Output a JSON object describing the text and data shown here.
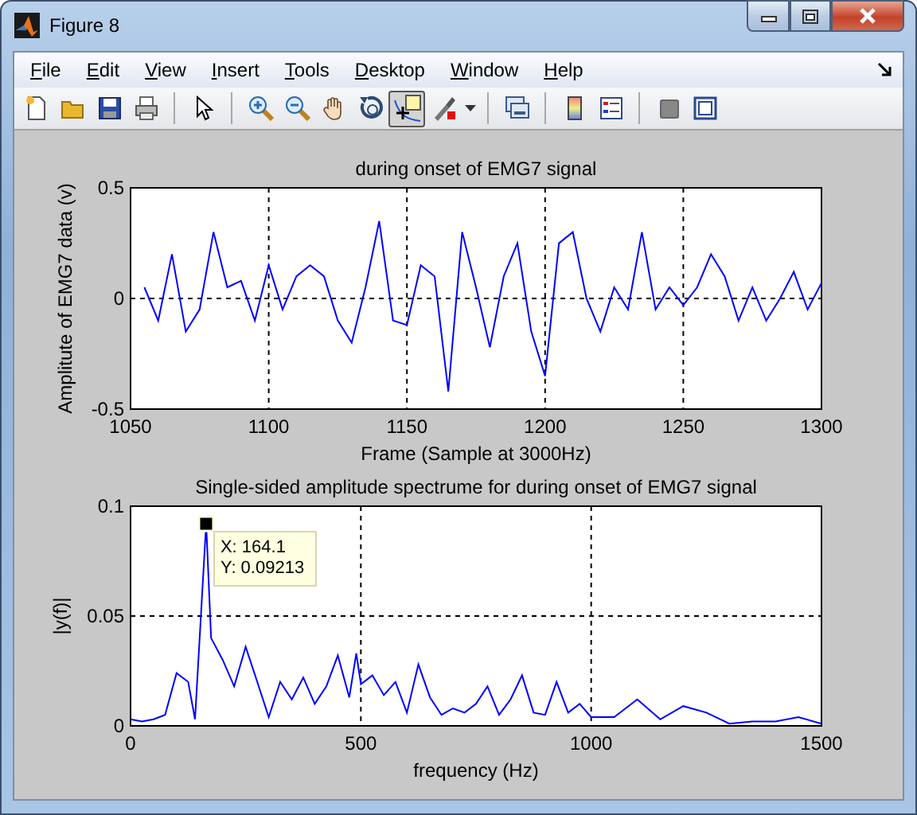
{
  "window": {
    "title": "Figure 8"
  },
  "menu": [
    {
      "label": "File"
    },
    {
      "label": "Edit"
    },
    {
      "label": "View"
    },
    {
      "label": "Insert"
    },
    {
      "label": "Tools"
    },
    {
      "label": "Desktop"
    },
    {
      "label": "Window"
    },
    {
      "label": "Help"
    }
  ],
  "toolbar": {
    "groups": [
      [
        {
          "kind": "new",
          "selected": false
        },
        {
          "kind": "open",
          "selected": false
        },
        {
          "kind": "save",
          "selected": false
        },
        {
          "kind": "print",
          "selected": false
        }
      ],
      [
        {
          "kind": "pointer",
          "selected": false
        }
      ],
      [
        {
          "kind": "zoom-in",
          "selected": false
        },
        {
          "kind": "zoom-out",
          "selected": false
        },
        {
          "kind": "pan",
          "selected": false
        },
        {
          "kind": "rotate",
          "selected": false
        },
        {
          "kind": "data-cursor",
          "selected": true
        },
        {
          "kind": "brush",
          "selected": false
        }
      ],
      [
        {
          "kind": "link",
          "selected": false
        }
      ],
      [
        {
          "kind": "colorbar",
          "selected": false
        },
        {
          "kind": "legend",
          "selected": false
        }
      ],
      [
        {
          "kind": "hide-tools",
          "selected": false
        },
        {
          "kind": "show-tools",
          "selected": false
        }
      ]
    ]
  },
  "figure": {
    "axes": [
      {
        "chart_data": {
          "type": "line",
          "grid": true,
          "title": "during onset of EMG7 signal",
          "xlabel": "Frame (Sample at 3000Hz)",
          "ylabel": "Amplitute of EMG7 data (v)",
          "xlim": [
            1050,
            1300
          ],
          "ylim": [
            -0.5,
            0.5
          ],
          "xticks": [
            {
              "value": 1050,
              "label": "1050"
            },
            {
              "value": 1100,
              "label": "1100"
            },
            {
              "value": 1150,
              "label": "1150"
            },
            {
              "value": 1200,
              "label": "1200"
            },
            {
              "value": 1250,
              "label": "1250"
            },
            {
              "value": 1300,
              "label": "1300"
            }
          ],
          "yticks": [
            {
              "value": -0.5,
              "label": "-0.5"
            },
            {
              "value": 0,
              "label": "0"
            },
            {
              "value": 0.5,
              "label": "0.5"
            }
          ],
          "x": [
            1055,
            1060,
            1065,
            1070,
            1075,
            1080,
            1085,
            1090,
            1095,
            1100,
            1105,
            1110,
            1115,
            1120,
            1125,
            1130,
            1135,
            1140,
            1145,
            1150,
            1155,
            1160,
            1165,
            1170,
            1175,
            1180,
            1185,
            1190,
            1195,
            1200,
            1205,
            1210,
            1215,
            1220,
            1225,
            1230,
            1235,
            1240,
            1245,
            1250,
            1255,
            1260,
            1265,
            1270,
            1275,
            1280,
            1285,
            1290,
            1295,
            1300
          ],
          "series": [
            {
              "color": "#0000ff",
              "values": [
                0.05,
                -0.1,
                0.2,
                -0.15,
                -0.05,
                0.3,
                0.05,
                0.08,
                -0.1,
                0.15,
                -0.05,
                0.1,
                0.15,
                0.1,
                -0.1,
                -0.2,
                0.05,
                0.35,
                -0.1,
                -0.12,
                0.15,
                0.1,
                -0.42,
                0.3,
                0.05,
                -0.22,
                0.1,
                0.25,
                -0.15,
                -0.35,
                0.25,
                0.3,
                0.0,
                -0.15,
                0.05,
                -0.05,
                0.3,
                -0.05,
                0.05,
                -0.03,
                0.05,
                0.2,
                0.1,
                -0.1,
                0.05,
                -0.1,
                0.0,
                0.12,
                -0.05,
                0.07
              ]
            }
          ]
        }
      },
      {
        "chart_data": {
          "type": "line",
          "grid": true,
          "title": "Single-sided amplitude spectrume for during onset of EMG7 signal",
          "xlabel": "frequency (Hz)",
          "ylabel": "|y(f)|",
          "xlim": [
            0,
            1500
          ],
          "ylim": [
            0,
            0.1
          ],
          "xticks": [
            {
              "value": 0,
              "label": "0"
            },
            {
              "value": 500,
              "label": "500"
            },
            {
              "value": 1000,
              "label": "1000"
            },
            {
              "value": 1500,
              "label": "1500"
            }
          ],
          "yticks": [
            {
              "value": 0,
              "label": "0"
            },
            {
              "value": 0.05,
              "label": "0.05"
            },
            {
              "value": 0.1,
              "label": "0.1"
            }
          ],
          "x": [
            0,
            25,
            50,
            75,
            100,
            125,
            140,
            164.1,
            175,
            200,
            225,
            250,
            275,
            300,
            325,
            350,
            375,
            400,
            425,
            450,
            475,
            490,
            500,
            525,
            550,
            575,
            600,
            625,
            650,
            675,
            700,
            725,
            750,
            775,
            800,
            825,
            850,
            875,
            900,
            925,
            950,
            975,
            1000,
            1050,
            1100,
            1150,
            1200,
            1250,
            1300,
            1350,
            1400,
            1450,
            1500
          ],
          "series": [
            {
              "color": "#0000ff",
              "values": [
                0.003,
                0.002,
                0.003,
                0.005,
                0.024,
                0.02,
                0.003,
                0.092,
                0.04,
                0.03,
                0.018,
                0.036,
                0.02,
                0.004,
                0.02,
                0.012,
                0.022,
                0.01,
                0.018,
                0.032,
                0.013,
                0.033,
                0.019,
                0.023,
                0.014,
                0.02,
                0.006,
                0.028,
                0.013,
                0.005,
                0.008,
                0.006,
                0.01,
                0.018,
                0.005,
                0.012,
                0.023,
                0.006,
                0.005,
                0.02,
                0.006,
                0.01,
                0.004,
                0.004,
                0.012,
                0.003,
                0.009,
                0.006,
                0.001,
                0.002,
                0.002,
                0.004,
                0.001
              ]
            }
          ],
          "annotations": [
            {
              "text": "X: 164.1"
            },
            {
              "text": "Y: 0.09213"
            }
          ]
        }
      }
    ]
  }
}
